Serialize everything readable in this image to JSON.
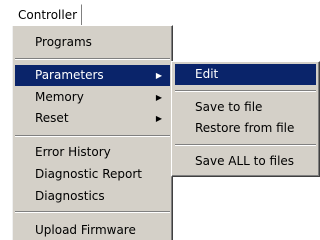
{
  "menubar": {
    "title": "Controller"
  },
  "menu": {
    "items": [
      {
        "label": "Programs"
      },
      {
        "label": "Parameters",
        "arrow": "▶"
      },
      {
        "label": "Memory",
        "arrow": "▶"
      },
      {
        "label": "Reset",
        "arrow": "▶"
      },
      {
        "label": "Error History"
      },
      {
        "label": "Diagnostic Report"
      },
      {
        "label": "Diagnostics"
      },
      {
        "label": "Upload Firmware"
      }
    ]
  },
  "submenu": {
    "items": [
      {
        "label": "Edit"
      },
      {
        "label": "Save to file"
      },
      {
        "label": "Restore from file"
      },
      {
        "label": "Save ALL to files"
      }
    ]
  },
  "colors": {
    "menu_bg": "#d4d0c8",
    "highlight": "#0a246a",
    "highlight_text": "#ffffff"
  }
}
